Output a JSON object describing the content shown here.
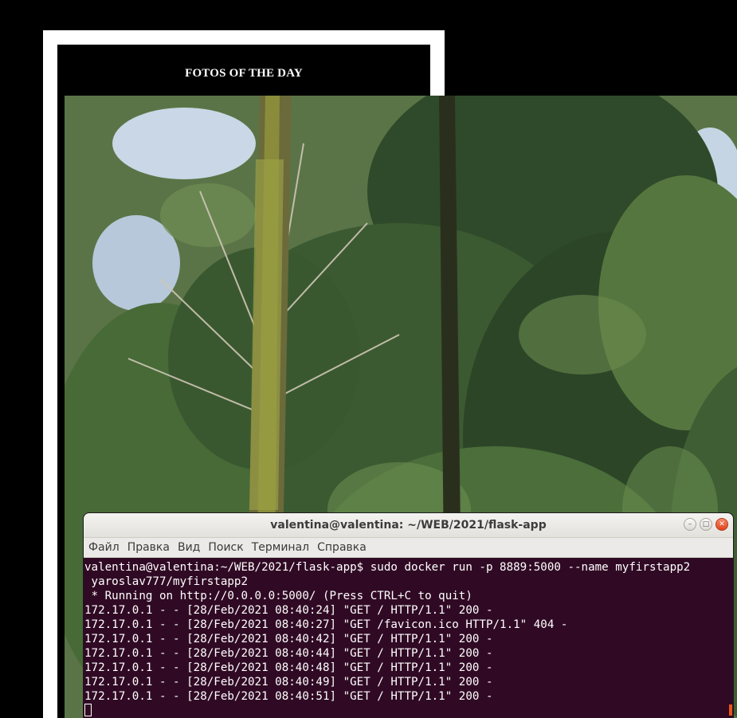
{
  "page": {
    "title": "FOTOS OF THE DAY"
  },
  "photo": {
    "alt": "forest-photo"
  },
  "terminal": {
    "title": "valentina@valentina: ~/WEB/2021/flask-app",
    "menu": [
      "Файл",
      "Правка",
      "Вид",
      "Поиск",
      "Терминал",
      "Справка"
    ],
    "lines": [
      "valentina@valentina:~/WEB/2021/flask-app$ sudo docker run -p 8889:5000 --name myfirstapp2",
      " yaroslav777/myfirstapp2",
      " * Running on http://0.0.0.0:5000/ (Press CTRL+C to quit)",
      "172.17.0.1 - - [28/Feb/2021 08:40:24] \"GET / HTTP/1.1\" 200 -",
      "172.17.0.1 - - [28/Feb/2021 08:40:27] \"GET /favicon.ico HTTP/1.1\" 404 -",
      "172.17.0.1 - - [28/Feb/2021 08:40:42] \"GET / HTTP/1.1\" 200 -",
      "172.17.0.1 - - [28/Feb/2021 08:40:44] \"GET / HTTP/1.1\" 200 -",
      "172.17.0.1 - - [28/Feb/2021 08:40:48] \"GET / HTTP/1.1\" 200 -",
      "172.17.0.1 - - [28/Feb/2021 08:40:49] \"GET / HTTP/1.1\" 200 -",
      "172.17.0.1 - - [28/Feb/2021 08:40:51] \"GET / HTTP/1.1\" 200 -"
    ],
    "colors": {
      "background": "#300a24",
      "text": "#ffffff",
      "close_button": "#e2431c"
    }
  }
}
